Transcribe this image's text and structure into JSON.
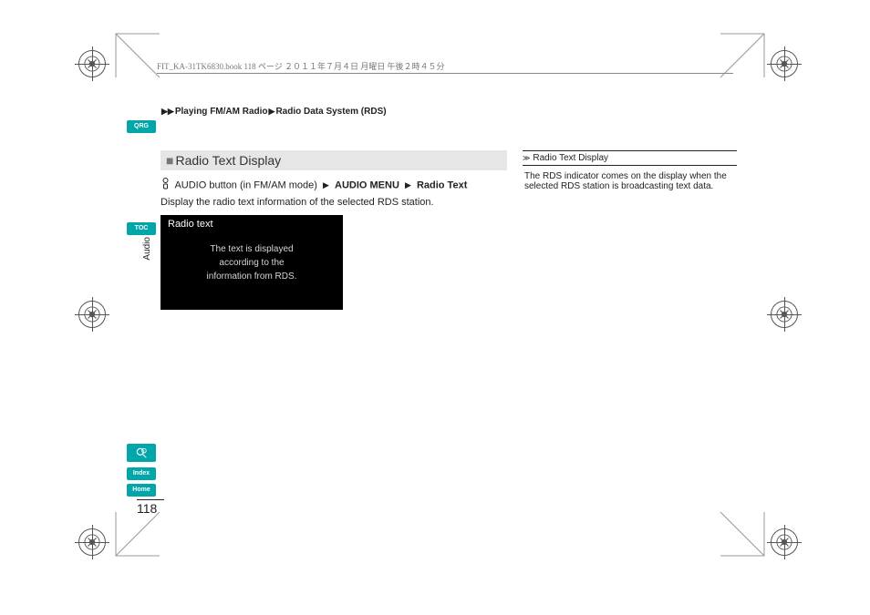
{
  "header_strip": "FIT_KA-31TK6830.book  118 ページ  ２０１１年７月４日  月曜日  午後２時４５分",
  "breadcrumb": {
    "a": "Playing FM/AM Radio",
    "b": "Radio Data System (RDS)"
  },
  "side": {
    "qrg": "QRG",
    "toc": "TOC",
    "audio": "Audio",
    "index": "Index",
    "home": "Home"
  },
  "main": {
    "section_title": "Radio Text Display",
    "step1": "AUDIO button (in FM/AM mode)",
    "step2_bold": "AUDIO MENU",
    "step3_bold": "Radio Text",
    "desc": "Display the radio text information of the selected RDS station.",
    "screenshot": {
      "header": "Radio text",
      "line1": "The text is displayed",
      "line2": "according to the",
      "line3": "information from RDS."
    }
  },
  "sidebox": {
    "title": "Radio Text Display",
    "body": "The RDS indicator comes on the display when the selected RDS station is broadcasting text data."
  },
  "page_number": "118"
}
